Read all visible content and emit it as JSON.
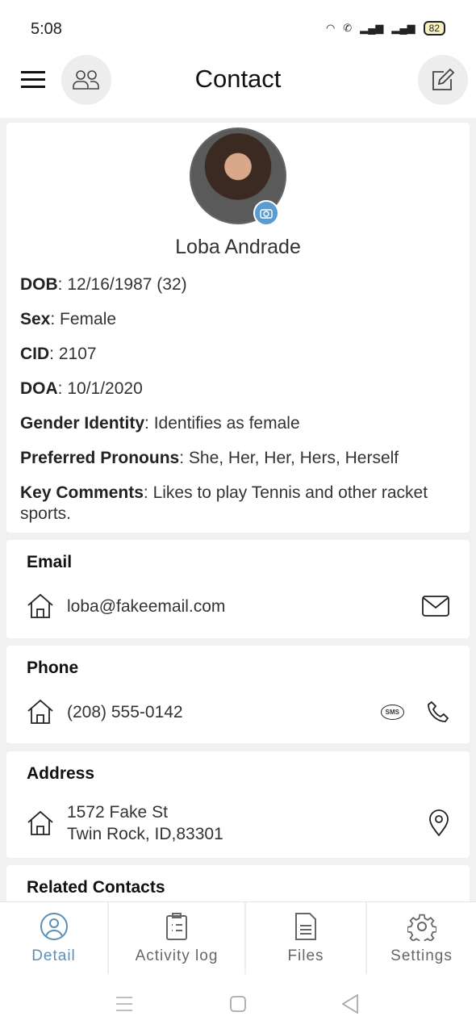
{
  "status_bar": {
    "time": "5:08",
    "battery": "82"
  },
  "header": {
    "title": "Contact"
  },
  "profile": {
    "name": "Loba Andrade",
    "fields": [
      {
        "label": "DOB",
        "value": "12/16/1987 (32)"
      },
      {
        "label": "Sex",
        "value": "Female"
      },
      {
        "label": "CID",
        "value": "2107"
      },
      {
        "label": "DOA",
        "value": "10/1/2020"
      },
      {
        "label": "Gender Identity",
        "value": "Identifies as female"
      },
      {
        "label": "Preferred Pronouns",
        "value": "She, Her, Her, Hers, Herself"
      },
      {
        "label": "Key Comments",
        "value": "Likes to play Tennis and other racket sports."
      }
    ]
  },
  "email": {
    "title": "Email",
    "value": "loba@fakeemail.com"
  },
  "phone": {
    "title": "Phone",
    "value": "(208) 555-0142",
    "sms_label": "SMS"
  },
  "address": {
    "title": "Address",
    "line1": "1572 Fake St",
    "line2": "Twin Rock, ID,83301"
  },
  "related": {
    "title": "Related Contacts"
  },
  "tabs": [
    {
      "label": "Detail",
      "active": true
    },
    {
      "label": "Activity log"
    },
    {
      "label": "Files"
    },
    {
      "label": "Settings"
    }
  ],
  "colors": {
    "accent": "#5b8fb5",
    "camera_badge": "#5a9bd0"
  }
}
